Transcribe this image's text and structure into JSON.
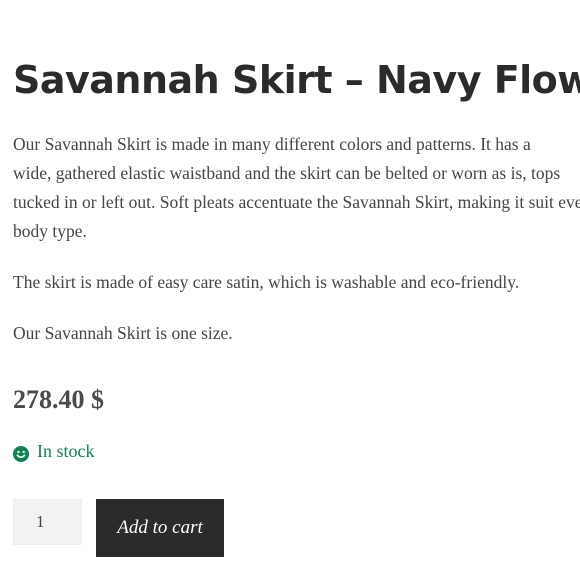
{
  "product": {
    "title": "Savannah Skirt – Navy Flower",
    "description": {
      "paragraph1": [
        "Our Savannah Skirt is made in many different colors and patterns. It has a",
        "wide, gathered elastic waistband and the skirt can be belted or worn as is, tops",
        "tucked in or left out. Soft pleats accentuate the Savannah Skirt, making it suit every",
        "body type."
      ],
      "paragraph2": "The skirt is made of easy care satin, which is washable and eco-friendly.",
      "paragraph3": "Our Savannah Skirt is one size."
    },
    "price": "278.40 $",
    "stock": {
      "text": "In stock",
      "icon": "smiley-icon",
      "color": "#0f834d"
    },
    "cart": {
      "quantity": "1",
      "button_label": "Add to cart",
      "button_color": "#2b2b2b"
    }
  }
}
